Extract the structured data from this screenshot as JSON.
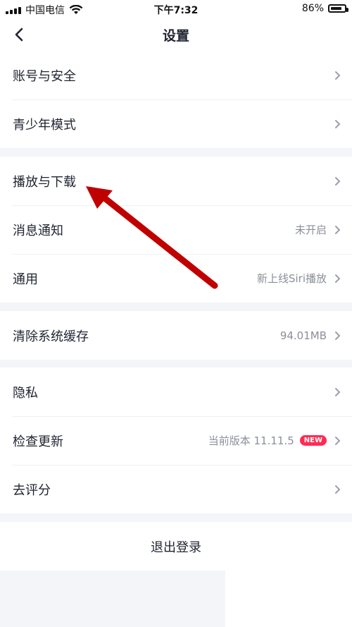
{
  "status_bar": {
    "carrier": "中国电信",
    "time": "下午7:32",
    "battery": "86%",
    "battery_level": 0.86
  },
  "nav": {
    "title": "设置"
  },
  "groups": [
    {
      "items": [
        {
          "label": "账号与安全",
          "value": ""
        },
        {
          "label": "青少年模式",
          "value": ""
        }
      ]
    },
    {
      "items": [
        {
          "label": "播放与下载",
          "value": ""
        },
        {
          "label": "消息通知",
          "value": "未开启"
        },
        {
          "label": "通用",
          "value": "新上线Siri播放"
        }
      ]
    },
    {
      "items": [
        {
          "label": "清除系统缓存",
          "value": "94.01MB"
        }
      ]
    },
    {
      "items": [
        {
          "label": "隐私",
          "value": ""
        },
        {
          "label": "检查更新",
          "value": "当前版本 11.11.5",
          "badge": "NEW"
        },
        {
          "label": "去评分",
          "value": ""
        }
      ]
    }
  ],
  "logout": {
    "label": "退出登录"
  },
  "colors": {
    "background": "#f4f5f9",
    "text": "#1f2430",
    "secondary": "#8a8f99",
    "badge": "#ff2b54",
    "annotation_arrow": "#c00000"
  },
  "icons": [
    "back-chevron-icon",
    "chevron-right-icon",
    "wifi-icon",
    "battery-icon",
    "signal-icon"
  ]
}
